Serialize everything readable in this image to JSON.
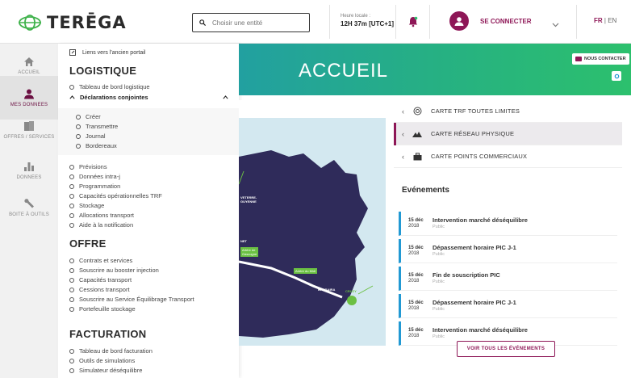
{
  "brand": {
    "name": "TERĒGA",
    "accent": "#8e1757",
    "green": "#6bc043"
  },
  "header": {
    "search_placeholder": "Choisir une entité",
    "time_label": "Heure locale :",
    "time_value": "12H 37m [UTC+1]",
    "connect_label": "SE CONNECTER",
    "lang_fr": "FR",
    "lang_sep": "|",
    "lang_en": "EN"
  },
  "rail": {
    "items": [
      {
        "label": "ACCUEIL",
        "icon": "home-icon"
      },
      {
        "label": "MES DONNEES",
        "icon": "user-icon"
      },
      {
        "label": "OFFRES / SERVICES",
        "icon": "documents-icon"
      },
      {
        "label": "DONNEES",
        "icon": "bar-chart-icon"
      },
      {
        "label": "BOITE À OUTILS",
        "icon": "wrench-icon"
      }
    ]
  },
  "menu": {
    "portal_link": "Liens vers l'ancien portail",
    "logistique": {
      "title": "LOGISTIQUE",
      "dashboard": "Tableau de bord logistique",
      "declarations": "Déclarations conjointes",
      "sub": [
        "Créer",
        "Transmettre",
        "Journal",
        "Bordereaux"
      ],
      "items": [
        "Prévisions",
        "Données intra-j",
        "Programmation",
        "Capacités opérationnelles TRF",
        "Stockage",
        "Allocations transport",
        "Aide à la notification"
      ]
    },
    "offre": {
      "title": "OFFRE",
      "items": [
        "Contrats et services",
        "Souscrire au booster injection",
        "Capacités transport",
        "Cessions transport",
        "Souscrire au Service Équilibrage Transport",
        "Portefeuille stockage"
      ]
    },
    "facturation": {
      "title": "FACTURATION",
      "items": [
        "Tableau de bord facturation",
        "Outils de simulations",
        "Simulateur déséquilibre"
      ]
    }
  },
  "banner": {
    "title": "ACCUEIL",
    "contact": "NOUS CONTACTER"
  },
  "map": {
    "labels": {
      "region1": "VETERRE-",
      "region2": "GUYENNE",
      "net": "NET",
      "artere_gascogne_1": "Artère de",
      "artere_gascogne_2": "Gascogne",
      "artere_midi": "Artère du Midi",
      "barbaira": "BARBAIRA",
      "cruzy": "CRUZY"
    }
  },
  "layers": [
    {
      "label": "CARTE TRF TOUTES LIMITES",
      "icon": "target-icon",
      "active": false
    },
    {
      "label": "CARTE RÉSEAU PHYSIQUE",
      "icon": "mountain-icon",
      "active": true
    },
    {
      "label": "CARTE POINTS COMMERCIAUX",
      "icon": "briefcase-icon",
      "active": false
    }
  ],
  "events": {
    "title": "Evénements",
    "items": [
      {
        "day": "15 déc",
        "year": "2018",
        "title": "Intervention marché déséquilibre",
        "status": "Public"
      },
      {
        "day": "15 déc",
        "year": "2018",
        "title": "Dépassement horaire PIC J-1",
        "status": "Public"
      },
      {
        "day": "15 déc",
        "year": "2018",
        "title": "Fin de souscription PIC",
        "status": "Public"
      },
      {
        "day": "15 déc",
        "year": "2018",
        "title": "Dépassement horaire PIC J-1",
        "status": "Public"
      },
      {
        "day": "15 déc",
        "year": "2018",
        "title": "Intervention marché déséquilibre",
        "status": "Public"
      }
    ],
    "all_button": "VOIR TOUS LES ÉVÉNEMENTS"
  }
}
